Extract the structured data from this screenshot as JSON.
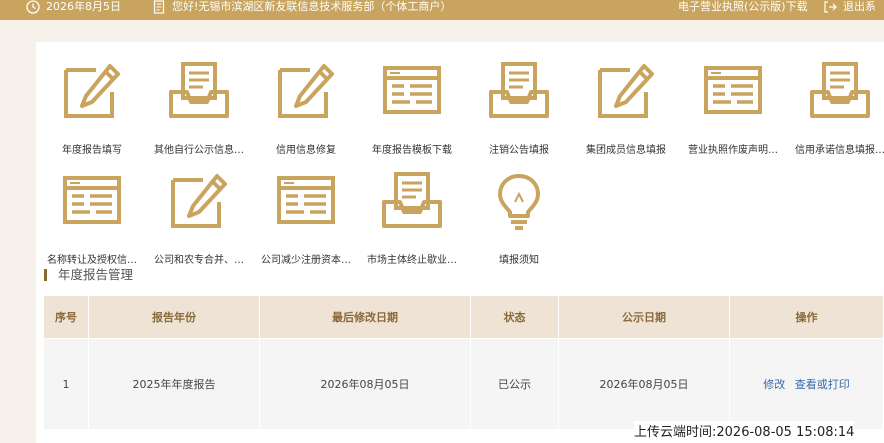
{
  "topbar": {
    "date": "2026年8月5日",
    "greeting": "您好!无锡市滨湖区新友联信息技术服务部（个体工商户）",
    "license_download": "电子营业执照(公示版)下载",
    "logout": "退出系"
  },
  "tiles": [
    {
      "label": "年度报告填写",
      "icon": "pencil-doc-icon"
    },
    {
      "label": "其他自行公示信息…",
      "icon": "inbox-doc-icon"
    },
    {
      "label": "信用信息修复",
      "icon": "pencil-doc-icon"
    },
    {
      "label": "年度报告模板下载",
      "icon": "window-doc-icon"
    },
    {
      "label": "注销公告填报",
      "icon": "inbox-doc-icon"
    },
    {
      "label": "集团成员信息填报",
      "icon": "pencil-doc-icon"
    },
    {
      "label": "营业执照作废声明…",
      "icon": "window-doc-icon"
    },
    {
      "label": "信用承诺信息填报…",
      "icon": "inbox-doc-icon"
    },
    {
      "label": "名称转让及授权信…",
      "icon": "window-doc-icon"
    },
    {
      "label": "公司和农专合并、…",
      "icon": "pencil-doc-icon"
    },
    {
      "label": "公司减少注册资本…",
      "icon": "window-doc-icon"
    },
    {
      "label": "市场主体终止歇业…",
      "icon": "inbox-doc-icon"
    },
    {
      "label": "填报须知",
      "icon": "lightbulb-icon"
    }
  ],
  "section": {
    "title": "年度报告管理"
  },
  "table": {
    "headers": [
      "序号",
      "报告年份",
      "最后修改日期",
      "状态",
      "公示日期",
      "操作"
    ],
    "rows": [
      {
        "no": "1",
        "year": "2025年年度报告",
        "modified": "2026年08月05日",
        "status": "已公示",
        "published": "2026年08月05日",
        "edit": "修改",
        "view": "查看或打印"
      }
    ]
  },
  "footer": {
    "upload_time": "上传云端时间:2026-08-05 15:08:14"
  },
  "colors": {
    "accent": "#c9a45f",
    "icon_gold": "#c9a45f",
    "header_bg": "#eee3d5",
    "link": "#3a6aa8"
  }
}
